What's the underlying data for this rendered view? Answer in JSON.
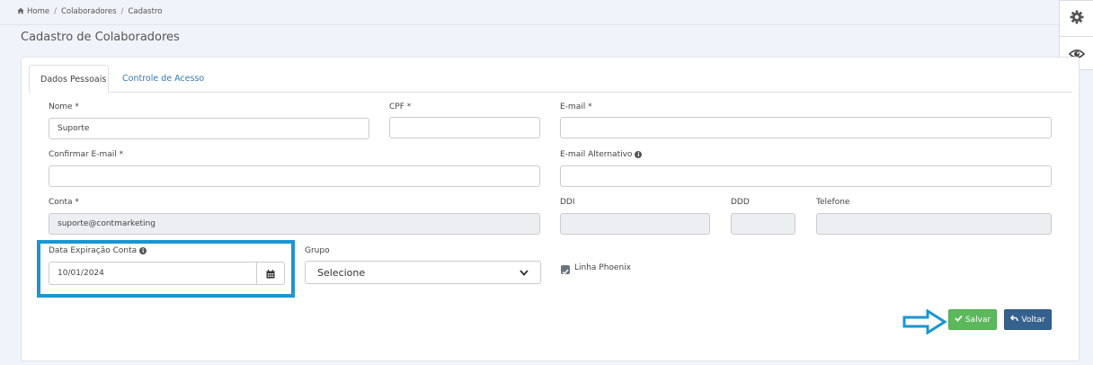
{
  "breadcrumb": {
    "home": "Home",
    "items": [
      "Colaboradores",
      "Cadastro"
    ],
    "separator": "/"
  },
  "page": {
    "title": "Cadastro de Colaboradores"
  },
  "side_tools": {
    "icons": [
      "gear-icon",
      "eye-icon"
    ]
  },
  "tabs": {
    "personal": "Dados Pessoais",
    "access": "Controle de Acesso",
    "active": "Dados Pessoais"
  },
  "form": {
    "nome": {
      "label": "Nome *",
      "value": "Suporte"
    },
    "cpf": {
      "label": "CPF *",
      "value": ""
    },
    "email": {
      "label": "E-mail *",
      "value": ""
    },
    "confirm_email": {
      "label": "Confirmar E-mail *",
      "value": ""
    },
    "alt_email": {
      "label": "E-mail Alternativo",
      "value": ""
    },
    "conta": {
      "label": "Conta *",
      "value": "suporte@contmarketing"
    },
    "ddi": {
      "label": "DDI",
      "value": ""
    },
    "ddd": {
      "label": "DDD",
      "value": ""
    },
    "telefone": {
      "label": "Telefone",
      "value": ""
    },
    "expiracao": {
      "label": "Data Expiração Conta",
      "value": "10/01/2024"
    },
    "grupo": {
      "label": "Grupo",
      "value": "Selecione"
    },
    "linha_phoenix": {
      "label": "Linha Phoenix",
      "checked": true
    }
  },
  "buttons": {
    "save": "Salvar",
    "back": "Voltar"
  },
  "colors": {
    "highlight": "#1b95d3",
    "save": "#5cb85c",
    "back": "#35618f",
    "link": "#337ab7"
  }
}
